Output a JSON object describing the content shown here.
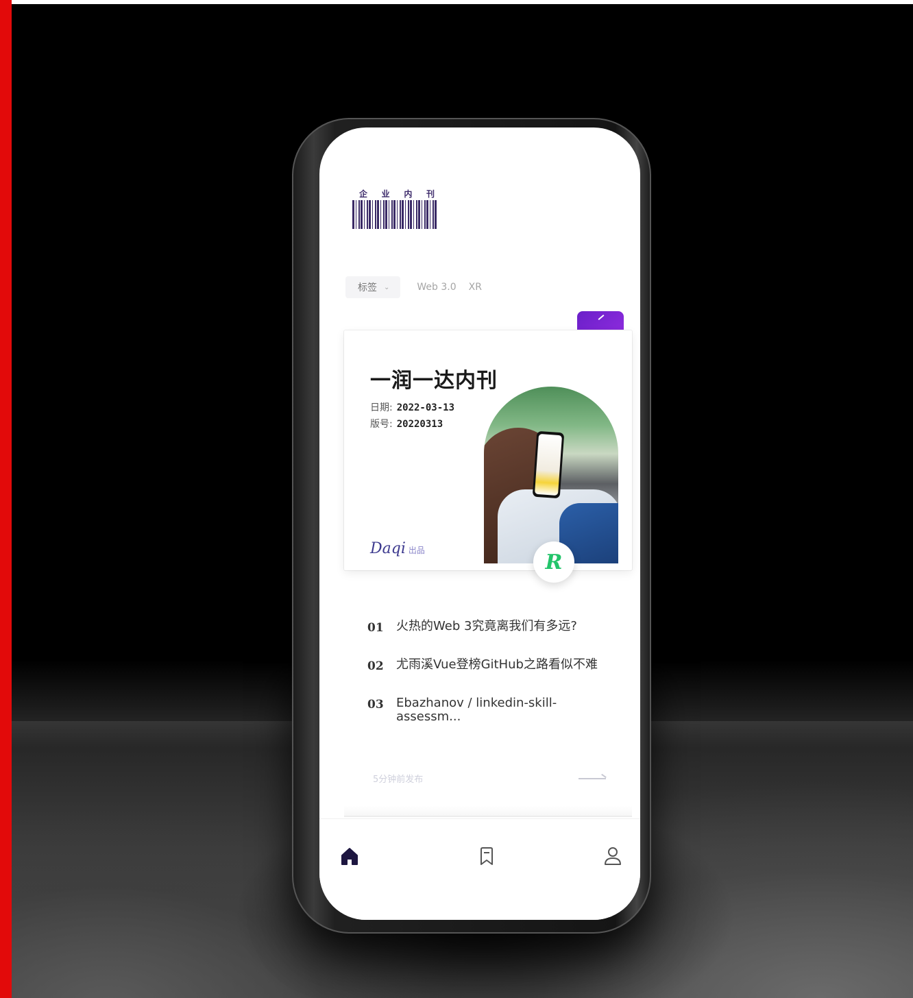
{
  "masthead": {
    "title_chars": [
      "企",
      "业",
      "内",
      "刊"
    ]
  },
  "tags": {
    "select_label": "标签",
    "items": [
      "Web 3.0",
      "XR"
    ]
  },
  "issue": {
    "title": "一润一达内刊",
    "date_label": "日期:",
    "date_value": "2022-03-13",
    "issue_label": "版号:",
    "issue_value": "20220313",
    "brand": "Daqi",
    "brand_suffix": "出品",
    "badge_letter": "R"
  },
  "articles": [
    {
      "num": "01",
      "title": "火热的Web 3究竟离我们有多远?"
    },
    {
      "num": "02",
      "title": "尤雨溪Vue登榜GitHub之路看似不难"
    },
    {
      "num": "03",
      "title": "Ebazhanov / linkedin-skill-assessm..."
    }
  ],
  "footer": {
    "hint": "5分钟前发布"
  },
  "nav": {
    "items": [
      "home",
      "bookmark",
      "user"
    ]
  },
  "colors": {
    "accent_purple": "#6a1fc9",
    "brand_navy": "#3d3a8f",
    "badge_green": "#22c46a",
    "side_bar_red": "#e20a0a"
  }
}
